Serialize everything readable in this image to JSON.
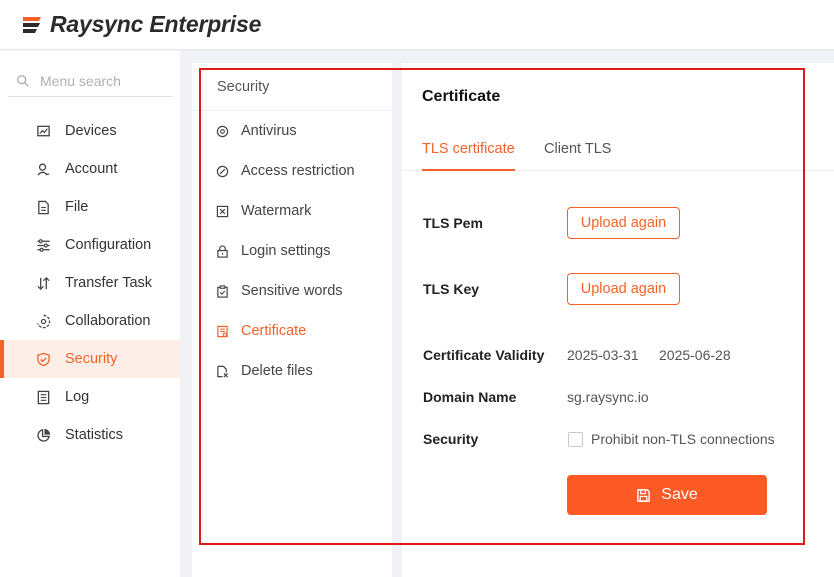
{
  "app": {
    "title": "Raysync Enterprise",
    "brand_color": "#f4622a"
  },
  "sidebar": {
    "search_placeholder": "Menu search",
    "items": [
      {
        "label": "Devices",
        "icon": "devices-icon"
      },
      {
        "label": "Account",
        "icon": "account-icon"
      },
      {
        "label": "File",
        "icon": "file-icon"
      },
      {
        "label": "Configuration",
        "icon": "configuration-icon"
      },
      {
        "label": "Transfer Task",
        "icon": "transfer-task-icon"
      },
      {
        "label": "Collaboration",
        "icon": "collaboration-icon"
      },
      {
        "label": "Security",
        "icon": "shield-icon",
        "active": true
      },
      {
        "label": "Log",
        "icon": "log-icon"
      },
      {
        "label": "Statistics",
        "icon": "statistics-icon"
      }
    ]
  },
  "submenu": {
    "header": "Security",
    "items": [
      {
        "label": "Antivirus",
        "icon": "antivirus-icon"
      },
      {
        "label": "Access restriction",
        "icon": "access-restriction-icon"
      },
      {
        "label": "Watermark",
        "icon": "watermark-icon"
      },
      {
        "label": "Login settings",
        "icon": "lock-icon"
      },
      {
        "label": "Sensitive words",
        "icon": "clipboard-icon"
      },
      {
        "label": "Certificate",
        "icon": "certificate-icon",
        "active": true
      },
      {
        "label": "Delete files",
        "icon": "delete-files-icon"
      }
    ]
  },
  "content": {
    "title": "Certificate",
    "tabs": [
      {
        "label": "TLS certificate",
        "active": true
      },
      {
        "label": "Client TLS"
      }
    ],
    "tls_pem": {
      "label": "TLS Pem",
      "button": "Upload again"
    },
    "tls_key": {
      "label": "TLS Key",
      "button": "Upload again"
    },
    "validity": {
      "label": "Certificate Validity",
      "start": "2025-03-31",
      "end": "2025-06-28"
    },
    "domain": {
      "label": "Domain Name",
      "value": "sg.raysync.io"
    },
    "security": {
      "label": "Security",
      "checkbox_label": "Prohibit non-TLS connections",
      "checked": false
    },
    "save_label": "Save"
  },
  "highlight_color": "#e0191d"
}
